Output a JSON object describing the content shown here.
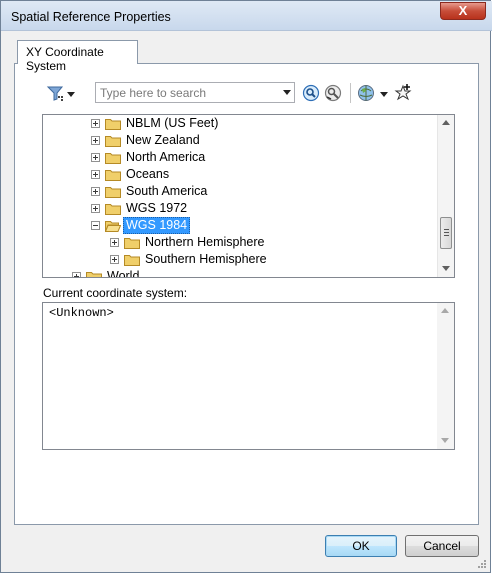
{
  "window": {
    "title": "Spatial Reference Properties",
    "close_glyph": "X"
  },
  "tabs": [
    {
      "label": "XY Coordinate System",
      "active": true
    }
  ],
  "toolbar": {
    "filter_icon": "filter-icon",
    "search": {
      "placeholder": "Type here to search",
      "value": ""
    },
    "search_icon": "search-icon",
    "clear_search_icon": "clear-search-icon",
    "globe_icon": "globe-icon",
    "add_favorite_icon": "add-favorite-icon"
  },
  "tree": {
    "items": [
      {
        "label": "NBLM (US Feet)",
        "level": 2,
        "expander": "plus",
        "open": false,
        "selected": false
      },
      {
        "label": "New Zealand",
        "level": 2,
        "expander": "plus",
        "open": false,
        "selected": false
      },
      {
        "label": "North America",
        "level": 2,
        "expander": "plus",
        "open": false,
        "selected": false
      },
      {
        "label": "Oceans",
        "level": 2,
        "expander": "plus",
        "open": false,
        "selected": false
      },
      {
        "label": "South America",
        "level": 2,
        "expander": "plus",
        "open": false,
        "selected": false
      },
      {
        "label": "WGS 1972",
        "level": 2,
        "expander": "plus",
        "open": false,
        "selected": false
      },
      {
        "label": "WGS 1984",
        "level": 2,
        "expander": "minus",
        "open": true,
        "selected": true
      },
      {
        "label": "Northern Hemisphere",
        "level": 3,
        "expander": "plus",
        "open": false,
        "selected": false
      },
      {
        "label": "Southern Hemisphere",
        "level": 3,
        "expander": "plus",
        "open": false,
        "selected": false
      },
      {
        "label": "World",
        "level": 1,
        "expander": "plus",
        "open": false,
        "selected": false
      }
    ]
  },
  "current": {
    "label": "Current coordinate system:",
    "value": "<Unknown>"
  },
  "buttons": {
    "ok": "OK",
    "cancel": "Cancel"
  },
  "colors": {
    "selection": "#3399ff",
    "titlebar": "#c8d8ec",
    "close": "#c74d39",
    "folder": "#e8c65a"
  }
}
